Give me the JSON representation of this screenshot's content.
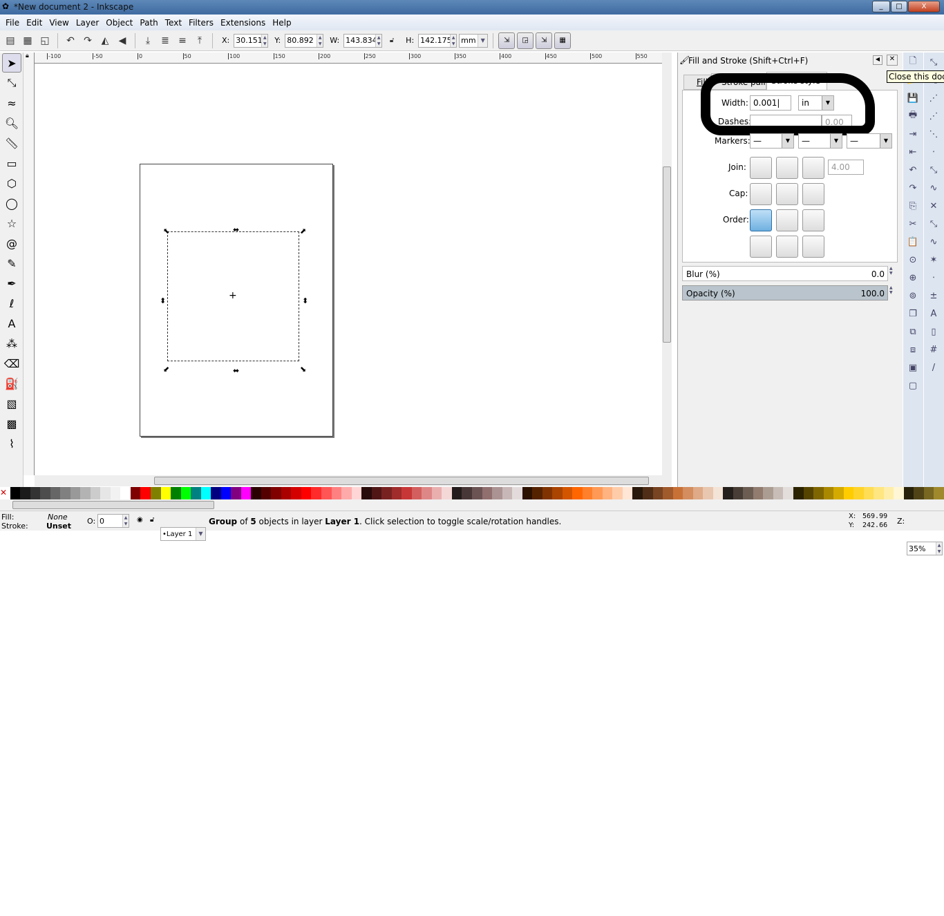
{
  "window": {
    "title": "*New document 2 - Inkscape",
    "min": "_",
    "max": "□",
    "close": "X"
  },
  "menu": [
    "File",
    "Edit",
    "View",
    "Layer",
    "Object",
    "Path",
    "Text",
    "Filters",
    "Extensions",
    "Help"
  ],
  "toolctl": {
    "x_label": "X:",
    "x": "30.151",
    "y_label": "Y:",
    "y": "80.892",
    "w_label": "W:",
    "w": "143.834",
    "h_label": "H:",
    "h": "142.175",
    "unit": "mm"
  },
  "ruler": {
    "top": [
      "-100",
      "-50",
      "0",
      "50",
      "100",
      "150",
      "200",
      "250",
      "300",
      "350",
      "400",
      "450",
      "500",
      "550"
    ]
  },
  "dock": {
    "title": "Fill and Stroke (Shift+Ctrl+F)",
    "tabs": [
      "Fill",
      "Stroke paint",
      "Stroke style"
    ],
    "tooltip": "Close this dock",
    "width_label": "Width:",
    "width_value": "0.001",
    "width_unit": "in",
    "dashes_label": "Dashes:",
    "dash_offset": "0.00",
    "markers_label": "Markers:",
    "join_label": "Join:",
    "miter": "4.00",
    "cap_label": "Cap:",
    "order_label": "Order:",
    "blur_label": "Blur (%)",
    "blur": "0.0",
    "opacity_label": "Opacity (%)",
    "opacity": "100.0"
  },
  "palette": [
    "#000000",
    "#1a1a1a",
    "#333333",
    "#4d4d4d",
    "#666666",
    "#808080",
    "#999999",
    "#b3b3b3",
    "#cccccc",
    "#e6e6e6",
    "#f2f2f2",
    "#ffffff",
    "#800000",
    "#ff0000",
    "#808000",
    "#ffff00",
    "#008000",
    "#00ff00",
    "#008080",
    "#00ffff",
    "#000080",
    "#0000ff",
    "#800080",
    "#ff00ff",
    "#2b0000",
    "#550000",
    "#800000",
    "#aa0000",
    "#d40000",
    "#ff0000",
    "#ff2a2a",
    "#ff5555",
    "#ff8080",
    "#ffaaaa",
    "#ffd5d5",
    "#280b0b",
    "#501616",
    "#782121",
    "#a02c2c",
    "#c83737",
    "#d35f5f",
    "#de8787",
    "#e9afaf",
    "#f4d7d7",
    "#241c1c",
    "#483737",
    "#6c5353",
    "#916f6f",
    "#ac9393",
    "#c8b7b7",
    "#e3dbdb",
    "#2b1100",
    "#552200",
    "#803300",
    "#aa4400",
    "#d45500",
    "#ff6600",
    "#ff7f2a",
    "#ff9955",
    "#ffb380",
    "#ffccaa",
    "#ffe6d5",
    "#28170b",
    "#502d16",
    "#784421",
    "#a05a2c",
    "#c87137",
    "#d38d5f",
    "#deaa87",
    "#e9c6af",
    "#f4e3d7",
    "#241f1c",
    "#483e37",
    "#6c5d53",
    "#917c6f",
    "#ac9d93",
    "#c8beb7",
    "#e3dedb",
    "#2b2200",
    "#554400",
    "#806600",
    "#aa8800",
    "#d4aa00",
    "#ffcc00",
    "#ffd42a",
    "#ffdd55",
    "#ffe680",
    "#ffeeaa",
    "#fff6d5",
    "#28220b",
    "#504416",
    "#786721",
    "#a0892c"
  ],
  "status": {
    "fill_label": "Fill:",
    "fill": "None",
    "stroke_label": "Stroke:",
    "stroke": "Unset",
    "o_label": "O:",
    "o": "0",
    "layer": "•Layer 1",
    "msg_1": "Group",
    "msg_2": " of ",
    "msg_3": "5",
    "msg_4": " objects in layer ",
    "msg_5": "Layer 1",
    "msg_6": ". Click selection to toggle scale/rotation handles.",
    "x_label": "X:",
    "x": "569.99",
    "y_label": "Y:",
    "y": "242.66",
    "z_label": "Z:",
    "zoom": "35%"
  }
}
